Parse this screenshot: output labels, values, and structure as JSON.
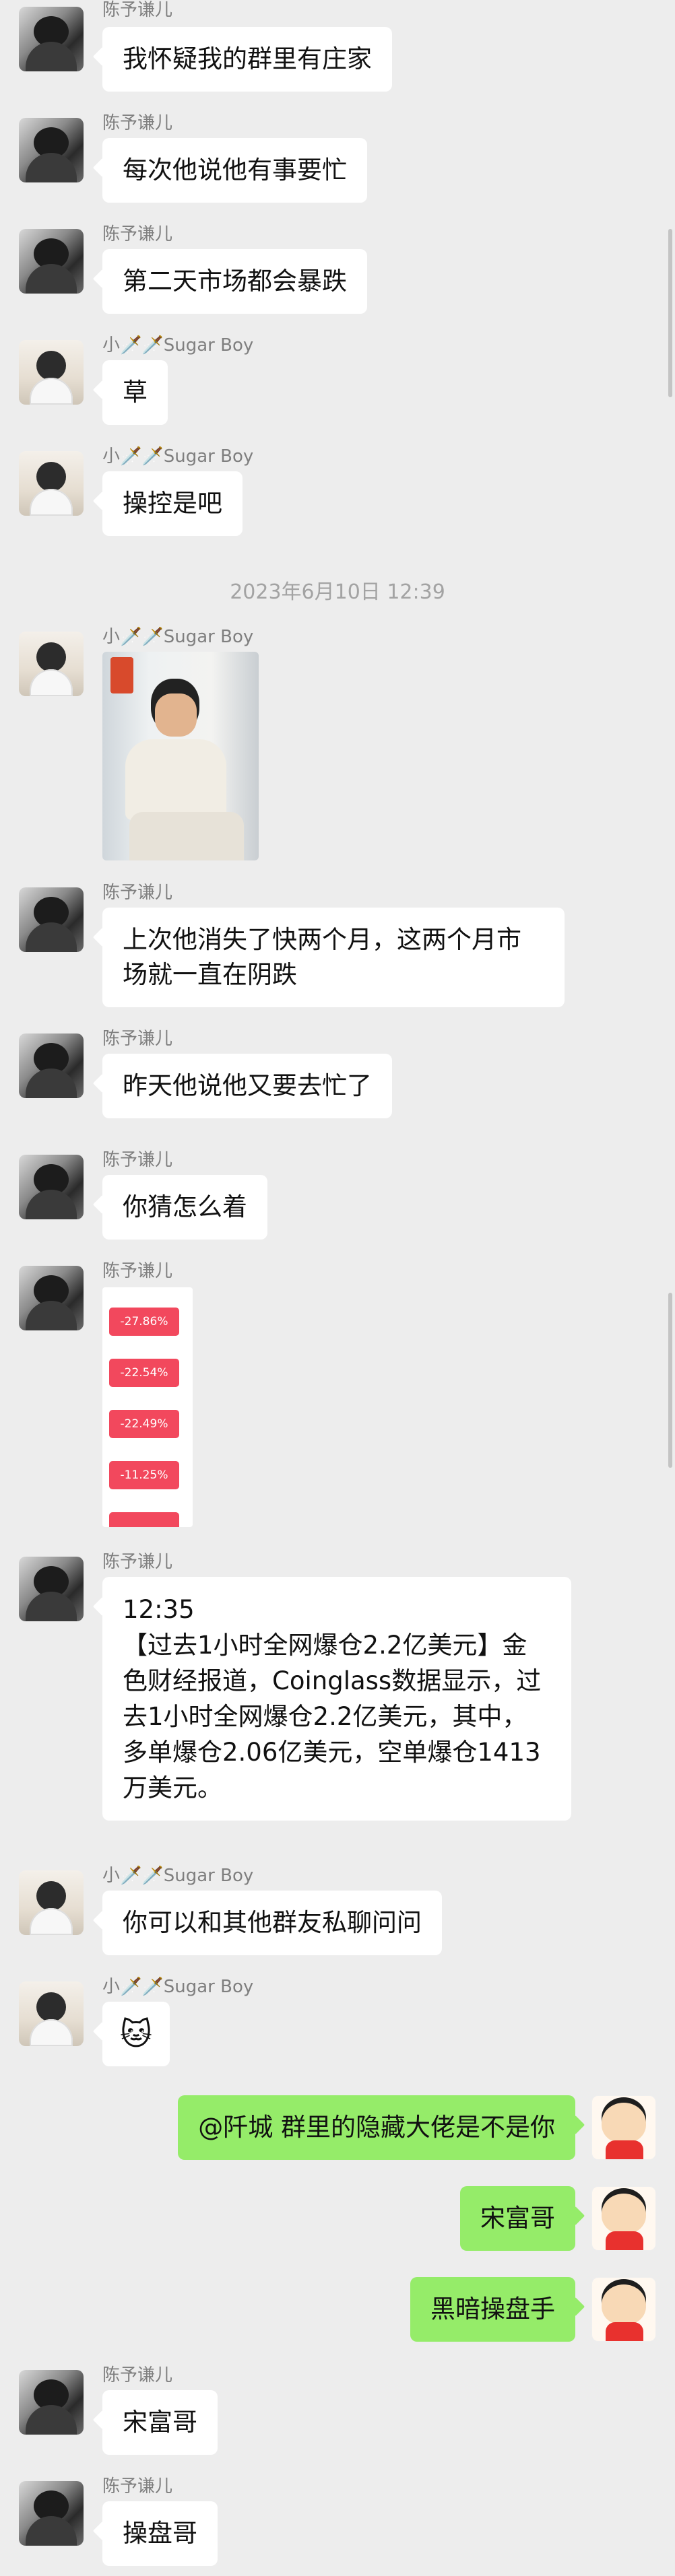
{
  "messages": {
    "m1": {
      "sender": "陈予谦儿",
      "text": "我怀疑我的群里有庄家"
    },
    "m2": {
      "sender": "陈予谦儿",
      "text": "每次他说他有事要忙"
    },
    "m3": {
      "sender": "陈予谦儿",
      "text": "第二天市场都会暴跌"
    },
    "m4": {
      "sender": "小🗡️🗡️Sugar Boy",
      "text": "草"
    },
    "m5": {
      "sender": "小🗡️🗡️Sugar Boy",
      "text": "操控是吧"
    },
    "timestamp": "2023年6月10日 12:39",
    "m6": {
      "sender": "小🗡️🗡️Sugar Boy"
    },
    "m7": {
      "sender": "陈予谦儿",
      "text": "上次他消失了快两个月，这两个月市场就一直在阴跌"
    },
    "m8": {
      "sender": "陈予谦儿",
      "text": "昨天他说他又要去忙了"
    },
    "m9": {
      "sender": "陈予谦儿",
      "text": "你猜怎么着"
    },
    "m10": {
      "sender": "陈予谦儿",
      "tags": [
        "-27.86%",
        "-22.54%",
        "-22.49%",
        "-11.25%"
      ]
    },
    "m11": {
      "sender": "陈予谦儿",
      "text": "12:35\n【过去1小时全网爆仓2.2亿美元】金色财经报道，Coinglass数据显示，过去1小时全网爆仓2.2亿美元，其中，多单爆仓2.06亿美元，空单爆仓1413万美元。"
    },
    "m12": {
      "sender": "小🗡️🗡️Sugar Boy",
      "text": "你可以和其他群友私聊问问"
    },
    "m13": {
      "sender": "小🗡️🗡️Sugar Boy",
      "text": "🐱"
    },
    "m14": {
      "text": "@阡城 群里的隐藏大佬是不是你"
    },
    "m15": {
      "text": "宋富哥"
    },
    "m16": {
      "text": "黑暗操盘手"
    },
    "m17": {
      "sender": "陈予谦儿",
      "text": "宋富哥"
    },
    "m18": {
      "sender": "陈予谦儿",
      "text": "操盘哥"
    }
  },
  "colors": {
    "background": "#ededed",
    "incoming_bubble": "#ffffff",
    "outgoing_bubble": "#95ec69",
    "loss_tag": "#f2485d"
  },
  "icons": {
    "incoming_avatar_a": "avatar",
    "incoming_avatar_b": "avatar",
    "self_avatar": "cartoon-avatar"
  }
}
